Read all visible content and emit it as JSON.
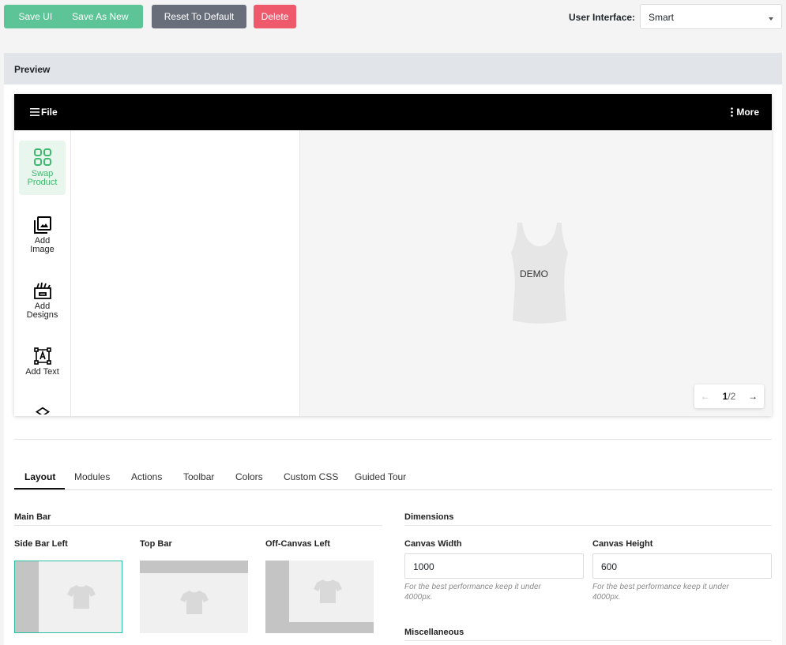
{
  "toolbar": {
    "save_ui": "Save UI",
    "save_as_new": "Save As New",
    "reset": "Reset To Default",
    "delete": "Delete",
    "ui_label": "User Interface:",
    "ui_value": "Smart"
  },
  "preview": {
    "title": "Preview",
    "file_label": "File",
    "more_label": "More",
    "sidebar": [
      {
        "label_1": "Swap",
        "label_2": "Product",
        "icon": "grid-icon"
      },
      {
        "label_1": "Add",
        "label_2": "Image",
        "icon": "image-icon"
      },
      {
        "label_1": "Add",
        "label_2": "Designs",
        "icon": "designs-icon"
      },
      {
        "label_1": "Add Text",
        "label_2": "",
        "icon": "text-icon"
      }
    ],
    "demo_text": "DEMO",
    "pager": {
      "current": "1",
      "total": "/2"
    }
  },
  "tabs": [
    "Layout",
    "Modules",
    "Actions",
    "Toolbar",
    "Colors",
    "Custom CSS",
    "Guided Tour"
  ],
  "layout": {
    "main_bar_title": "Main Bar",
    "options": [
      "Side Bar Left",
      "Top Bar",
      "Off-Canvas Left"
    ],
    "selected": "Side Bar Left"
  },
  "dimensions": {
    "title": "Dimensions",
    "width_label": "Canvas Width",
    "width_value": "1000",
    "height_label": "Canvas Height",
    "height_value": "600",
    "hint": "For the best performance keep it under 4000px.",
    "misc_title": "Miscellaneous"
  },
  "colors": {
    "green": "#5cc497",
    "gray": "#686e7a",
    "red": "#ee5a6c",
    "accent": "#27c0a2"
  }
}
